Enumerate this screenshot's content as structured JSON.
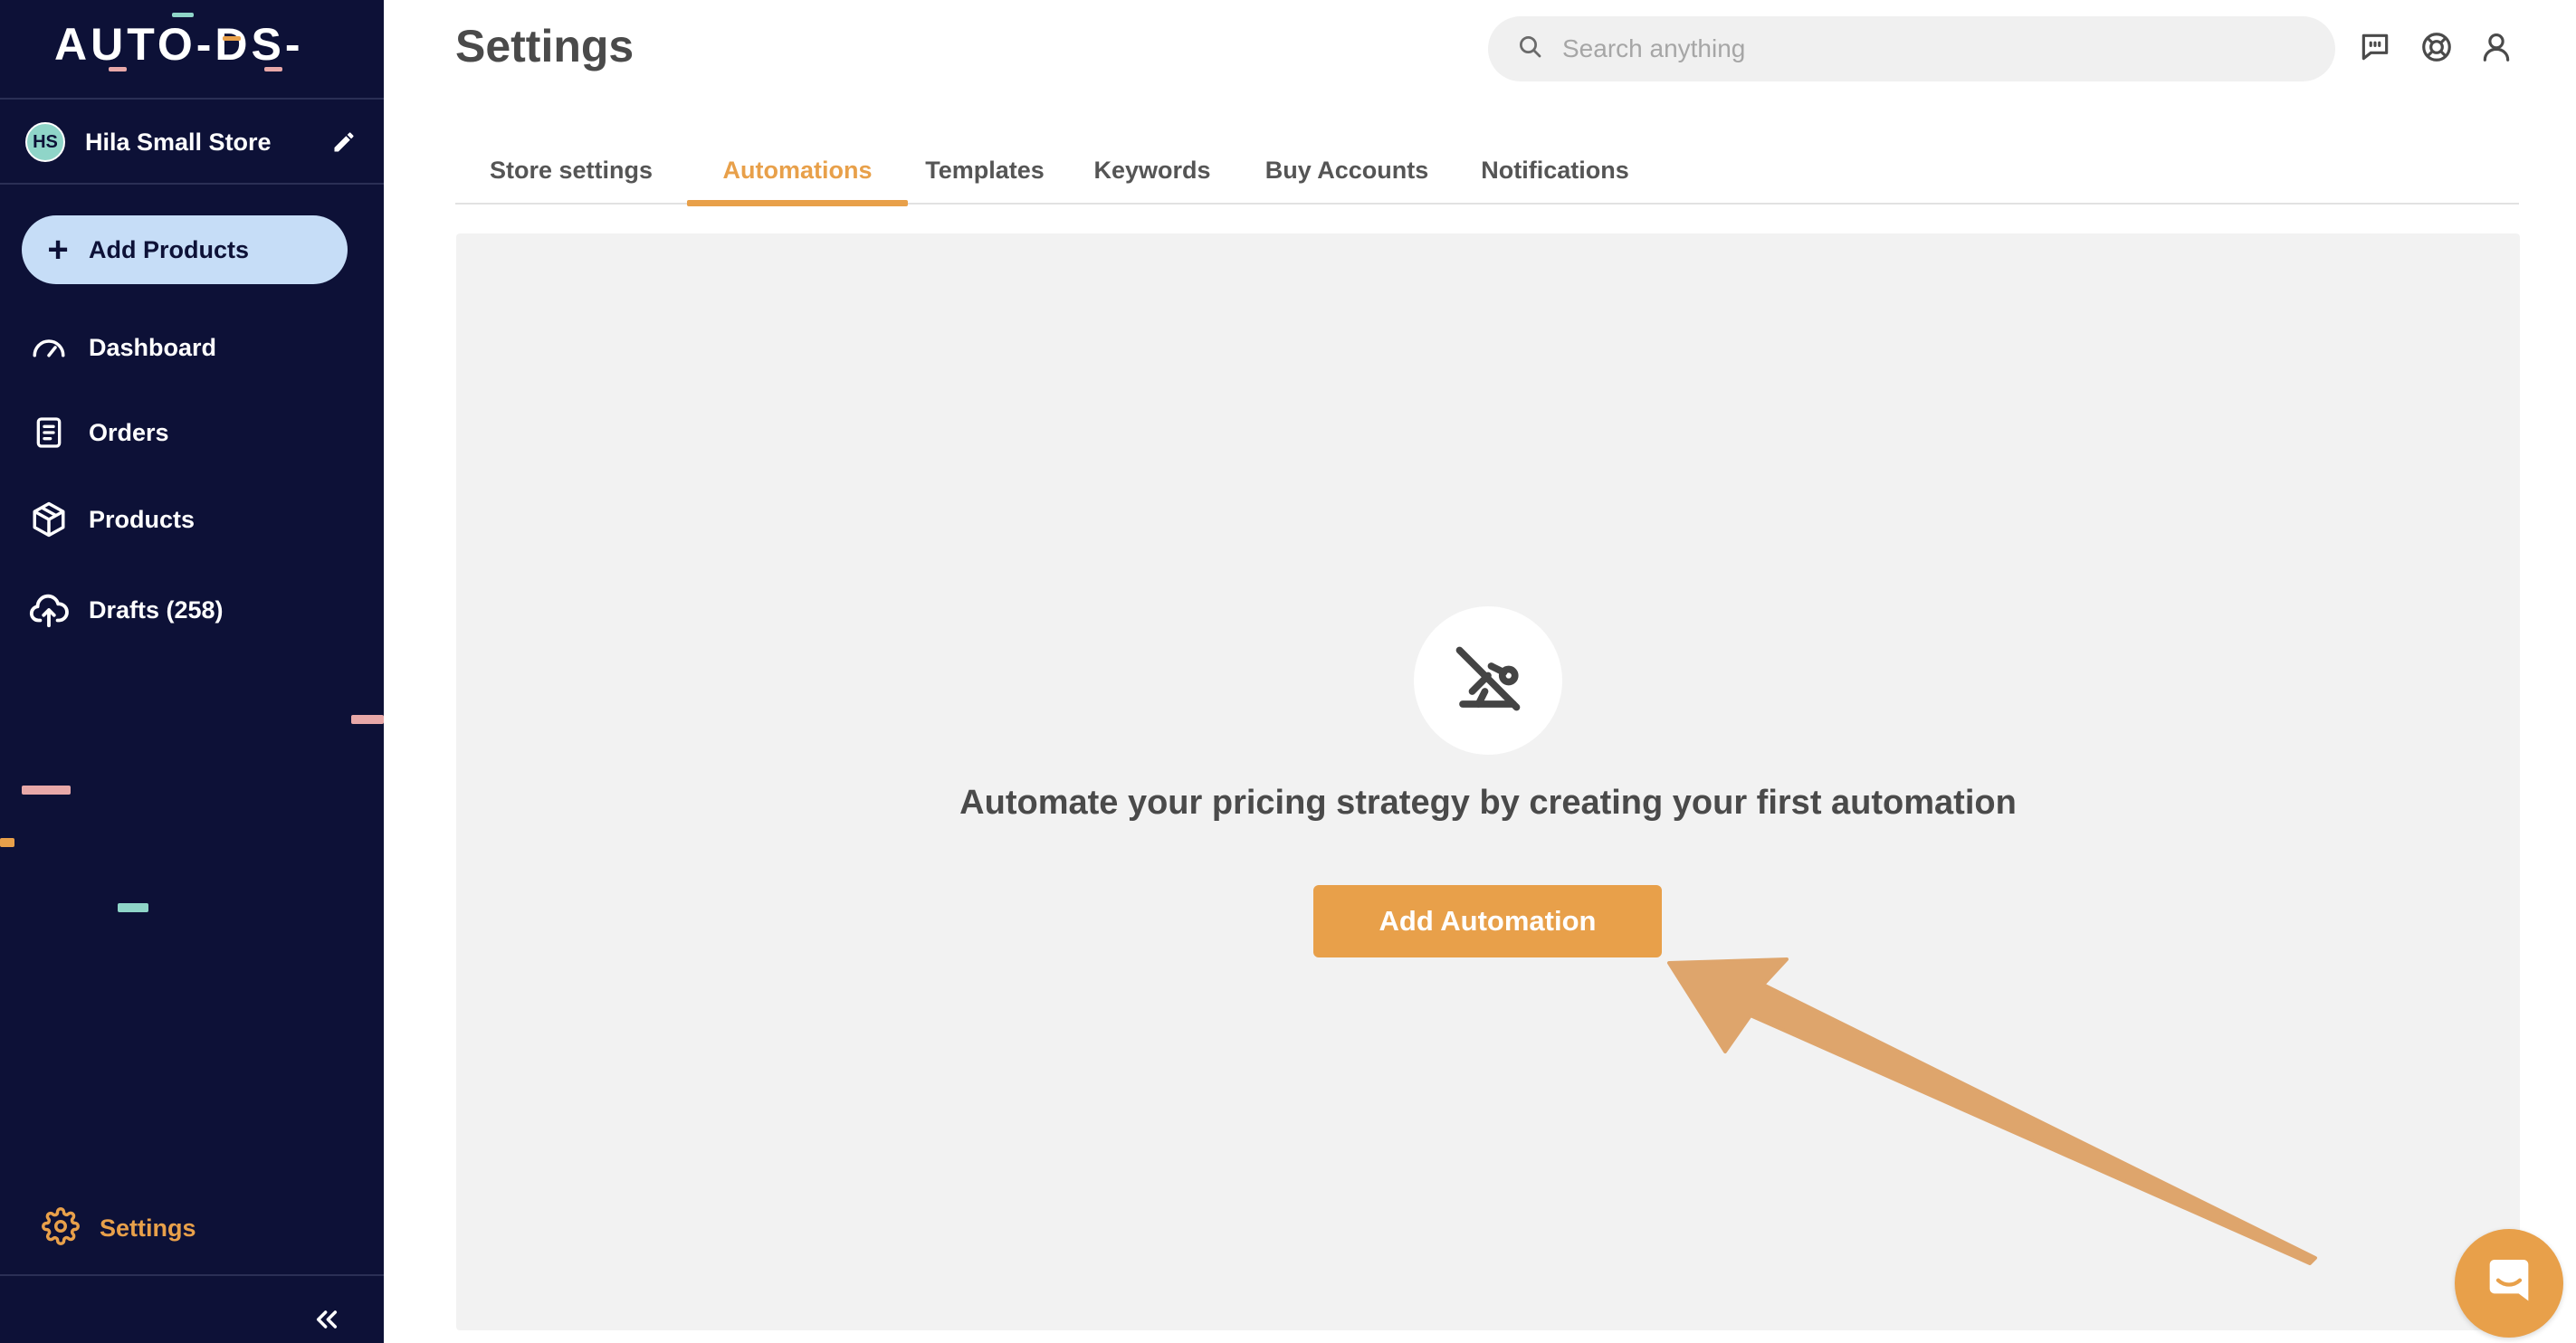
{
  "app": {
    "logo_text": "AUTO-DS-",
    "page_title": "Settings"
  },
  "sidebar": {
    "store": {
      "initials": "HS",
      "name": "Hila Small Store"
    },
    "add_products_label": "Add Products",
    "items": [
      {
        "label": "Dashboard",
        "icon": "gauge-icon"
      },
      {
        "label": "Orders",
        "icon": "clipboard-icon"
      },
      {
        "label": "Products",
        "icon": "box-icon"
      },
      {
        "label": "Drafts (258)",
        "icon": "cloud-upload-icon"
      }
    ],
    "settings_label": "Settings"
  },
  "header": {
    "search_placeholder": "Search anything"
  },
  "tabs": [
    {
      "label": "Store settings",
      "active": false
    },
    {
      "label": "Automations",
      "active": true
    },
    {
      "label": "Templates",
      "active": false
    },
    {
      "label": "Keywords",
      "active": false
    },
    {
      "label": "Buy Accounts",
      "active": false
    },
    {
      "label": "Notifications",
      "active": false
    }
  ],
  "empty_state": {
    "message": "Automate your pricing strategy by creating your first automation",
    "button_label": "Add Automation"
  },
  "colors": {
    "sidebar_bg": "#0d1137",
    "accent": "#e8a04a",
    "add_products_bg": "#c6ddf7",
    "panel_bg": "#f2f2f2"
  }
}
